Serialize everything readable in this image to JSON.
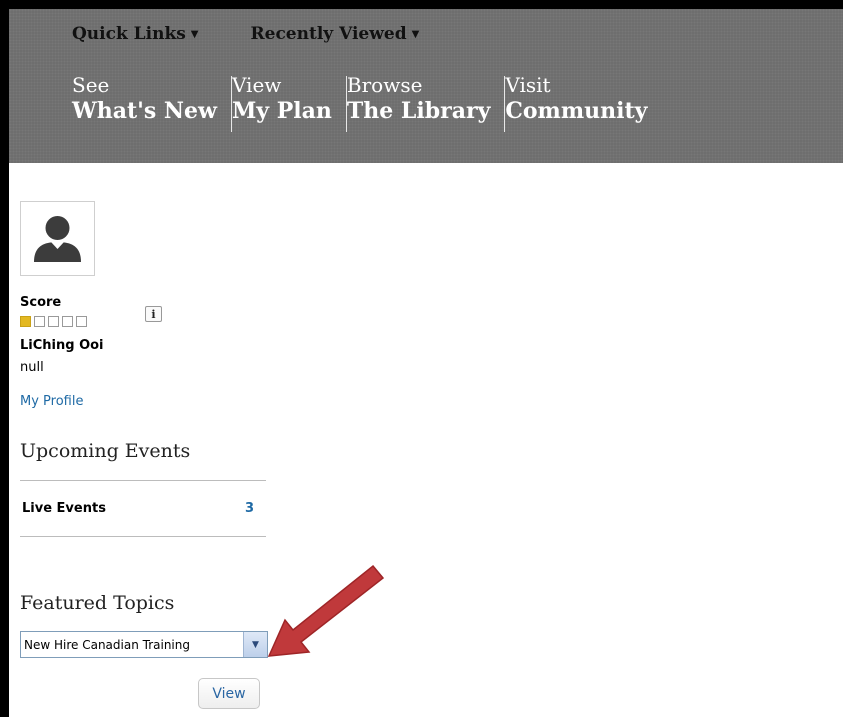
{
  "header": {
    "quick_links": "Quick Links",
    "recently_viewed": "Recently Viewed",
    "nav": [
      {
        "top": "See",
        "bottom": "What's New"
      },
      {
        "top": "View",
        "bottom": "My Plan"
      },
      {
        "top": "Browse",
        "bottom": "The Library"
      },
      {
        "top": "Visit",
        "bottom": "Community"
      }
    ]
  },
  "profile": {
    "score_label": "Score",
    "score": {
      "filled": 1,
      "total": 5
    },
    "name": "LiChing Ooi",
    "subtitle": "null",
    "profile_link": "My Profile"
  },
  "events": {
    "title": "Upcoming Events",
    "live_label": "Live Events",
    "live_count": "3"
  },
  "featured": {
    "title": "Featured Topics",
    "selected": "New Hire Canadian Training",
    "view_label": "View"
  },
  "colors": {
    "header_bg": "#6e6e6e",
    "link": "#1f6aa5",
    "score_filled": "#e3b821",
    "annotation_arrow": "#c0393b"
  }
}
